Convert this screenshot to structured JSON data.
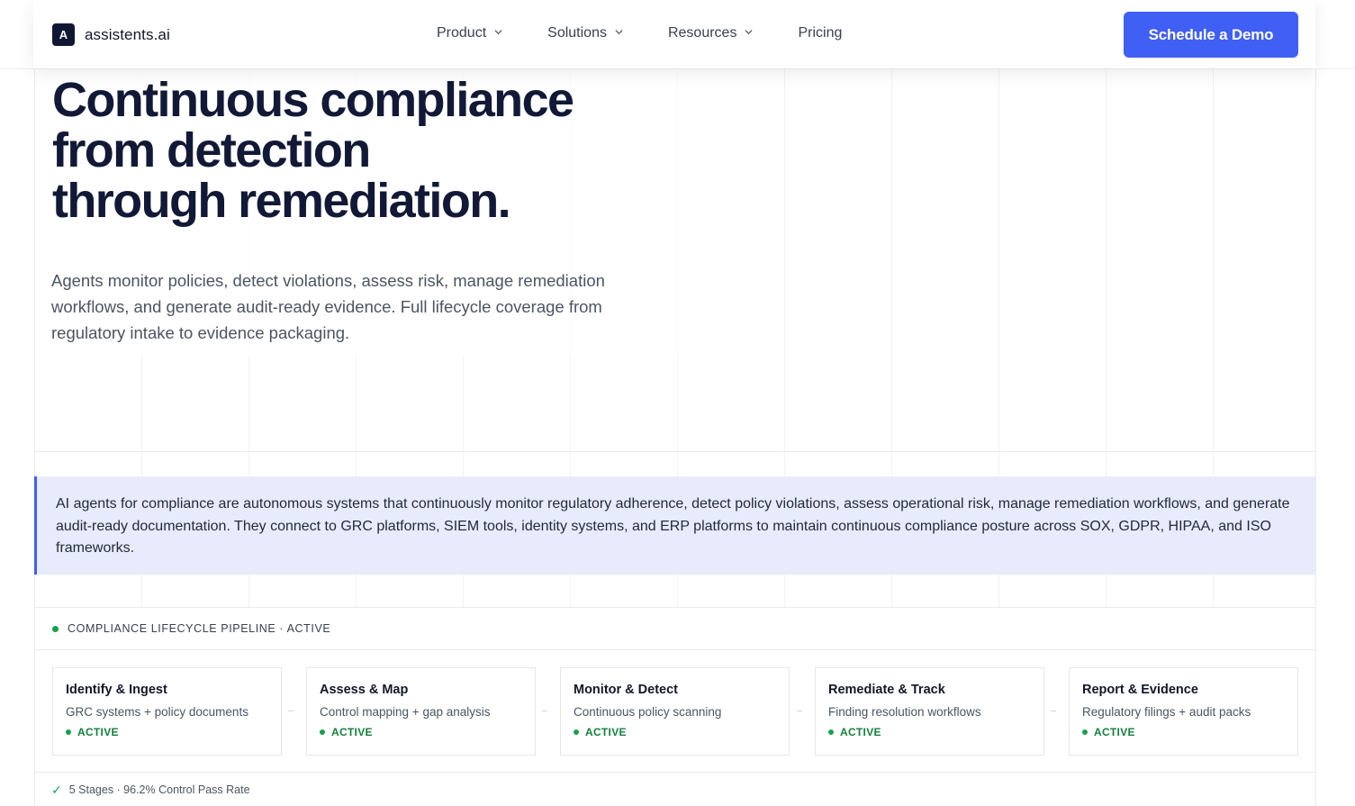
{
  "brand": {
    "logo_letter": "A",
    "name": "assistents.ai"
  },
  "nav": {
    "items": [
      {
        "label": "Product"
      },
      {
        "label": "Solutions"
      },
      {
        "label": "Resources"
      }
    ],
    "pricing_label": "Pricing",
    "cta_label": "Schedule a Demo"
  },
  "hero": {
    "title_line1": "Continuous compliance",
    "title_line2": "from detection",
    "title_line3": "through remediation.",
    "subtitle": "Agents monitor policies, detect violations, assess risk, manage remediation workflows, and generate audit-ready evidence. Full lifecycle coverage from regulatory intake to evidence packaging."
  },
  "definition": "AI agents for compliance are autonomous systems that continuously monitor regulatory adherence, detect policy violations, assess operational risk, manage remediation workflows, and generate audit-ready documentation. They connect to GRC platforms, SIEM tools, identity systems, and ERP platforms to maintain continuous compliance posture across SOX, GDPR, HIPAA, and ISO frameworks.",
  "pipeline": {
    "title": "COMPLIANCE LIFECYCLE PIPELINE · ACTIVE",
    "stages": [
      {
        "name": "Identify & Ingest",
        "desc": "GRC systems + policy documents",
        "status": "ACTIVE"
      },
      {
        "name": "Assess & Map",
        "desc": "Control mapping + gap analysis",
        "status": "ACTIVE"
      },
      {
        "name": "Monitor & Detect",
        "desc": "Continuous policy scanning",
        "status": "ACTIVE"
      },
      {
        "name": "Remediate & Track",
        "desc": "Finding resolution workflows",
        "status": "ACTIVE"
      },
      {
        "name": "Report & Evidence",
        "desc": "Regulatory filings + audit packs",
        "status": "ACTIVE"
      }
    ],
    "footer": "5 Stages · 96.2% Control Pass Rate",
    "status_color": "#16a34a"
  },
  "colors": {
    "accent": "#3f5ff5",
    "heading": "#111936",
    "callout_bg": "#e8ebfb"
  }
}
